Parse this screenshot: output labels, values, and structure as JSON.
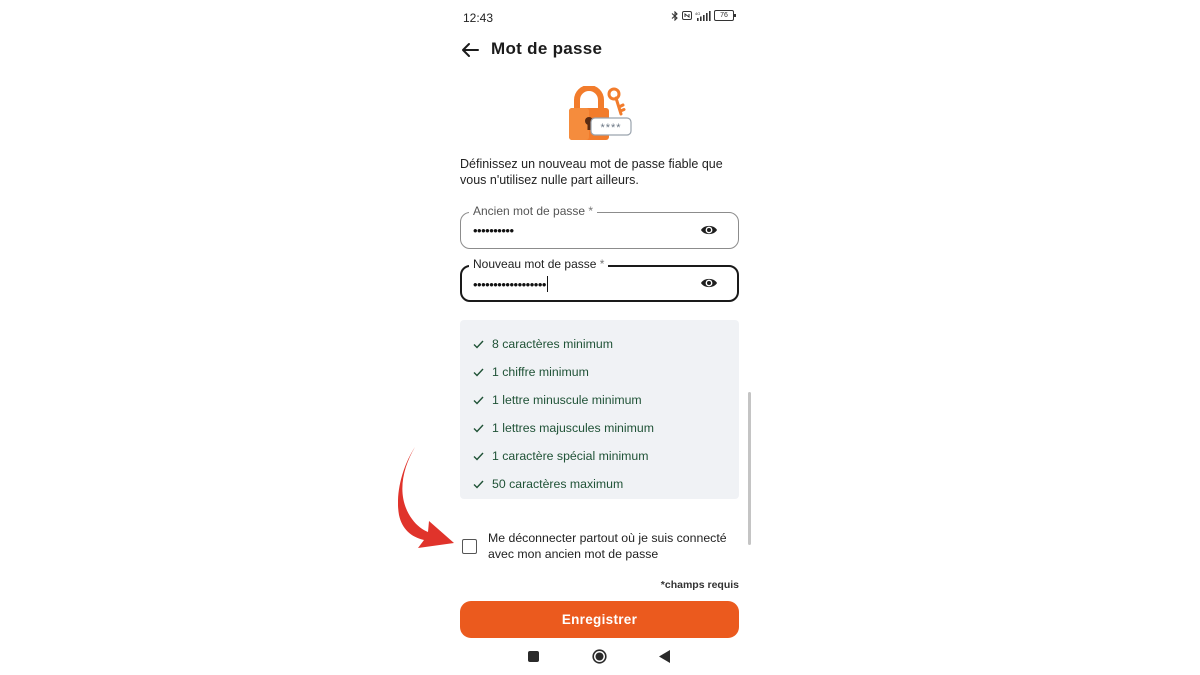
{
  "status_bar": {
    "time": "12:43",
    "battery": "76",
    "network": "4G"
  },
  "header": {
    "title": "Mot de passe"
  },
  "intro_text": "Définissez un nouveau mot de passe fiable que vous n'utilisez nulle part ailleurs.",
  "illustration": {
    "mask_text": "****"
  },
  "fields": {
    "old_password": {
      "label": "Ancien mot de passe",
      "required_mark": "*",
      "value": "••••••••••"
    },
    "new_password": {
      "label": "Nouveau mot de passe",
      "required_mark": "*",
      "value": "••••••••••••••••••"
    }
  },
  "requirements": [
    {
      "label": "8 caractères minimum",
      "met": true
    },
    {
      "label": "1 chiffre minimum",
      "met": true
    },
    {
      "label": "1 lettre minuscule minimum",
      "met": true
    },
    {
      "label": "1 lettres majuscules minimum",
      "met": true
    },
    {
      "label": "1 caractère spécial minimum",
      "met": true
    },
    {
      "label": "50 caractères maximum",
      "met": true
    }
  ],
  "logout_everywhere": {
    "label": "Me déconnecter partout où je suis connecté avec mon ancien mot de passe",
    "checked": false
  },
  "required_note": "*champs requis",
  "save_button": {
    "label": "Enregistrer"
  },
  "icons": {
    "back": "arrow-left-icon",
    "eye": "eye-icon",
    "check": "check-icon",
    "lock": "padlock-key-icon",
    "nav_recents": "square-icon",
    "nav_home": "circle-icon",
    "nav_back": "triangle-icon"
  },
  "colors": {
    "accent": "#eb5a1e",
    "requirement_text": "#1f5236",
    "requirements_bg": "#f0f2f5",
    "annotation": "#e0332b"
  }
}
